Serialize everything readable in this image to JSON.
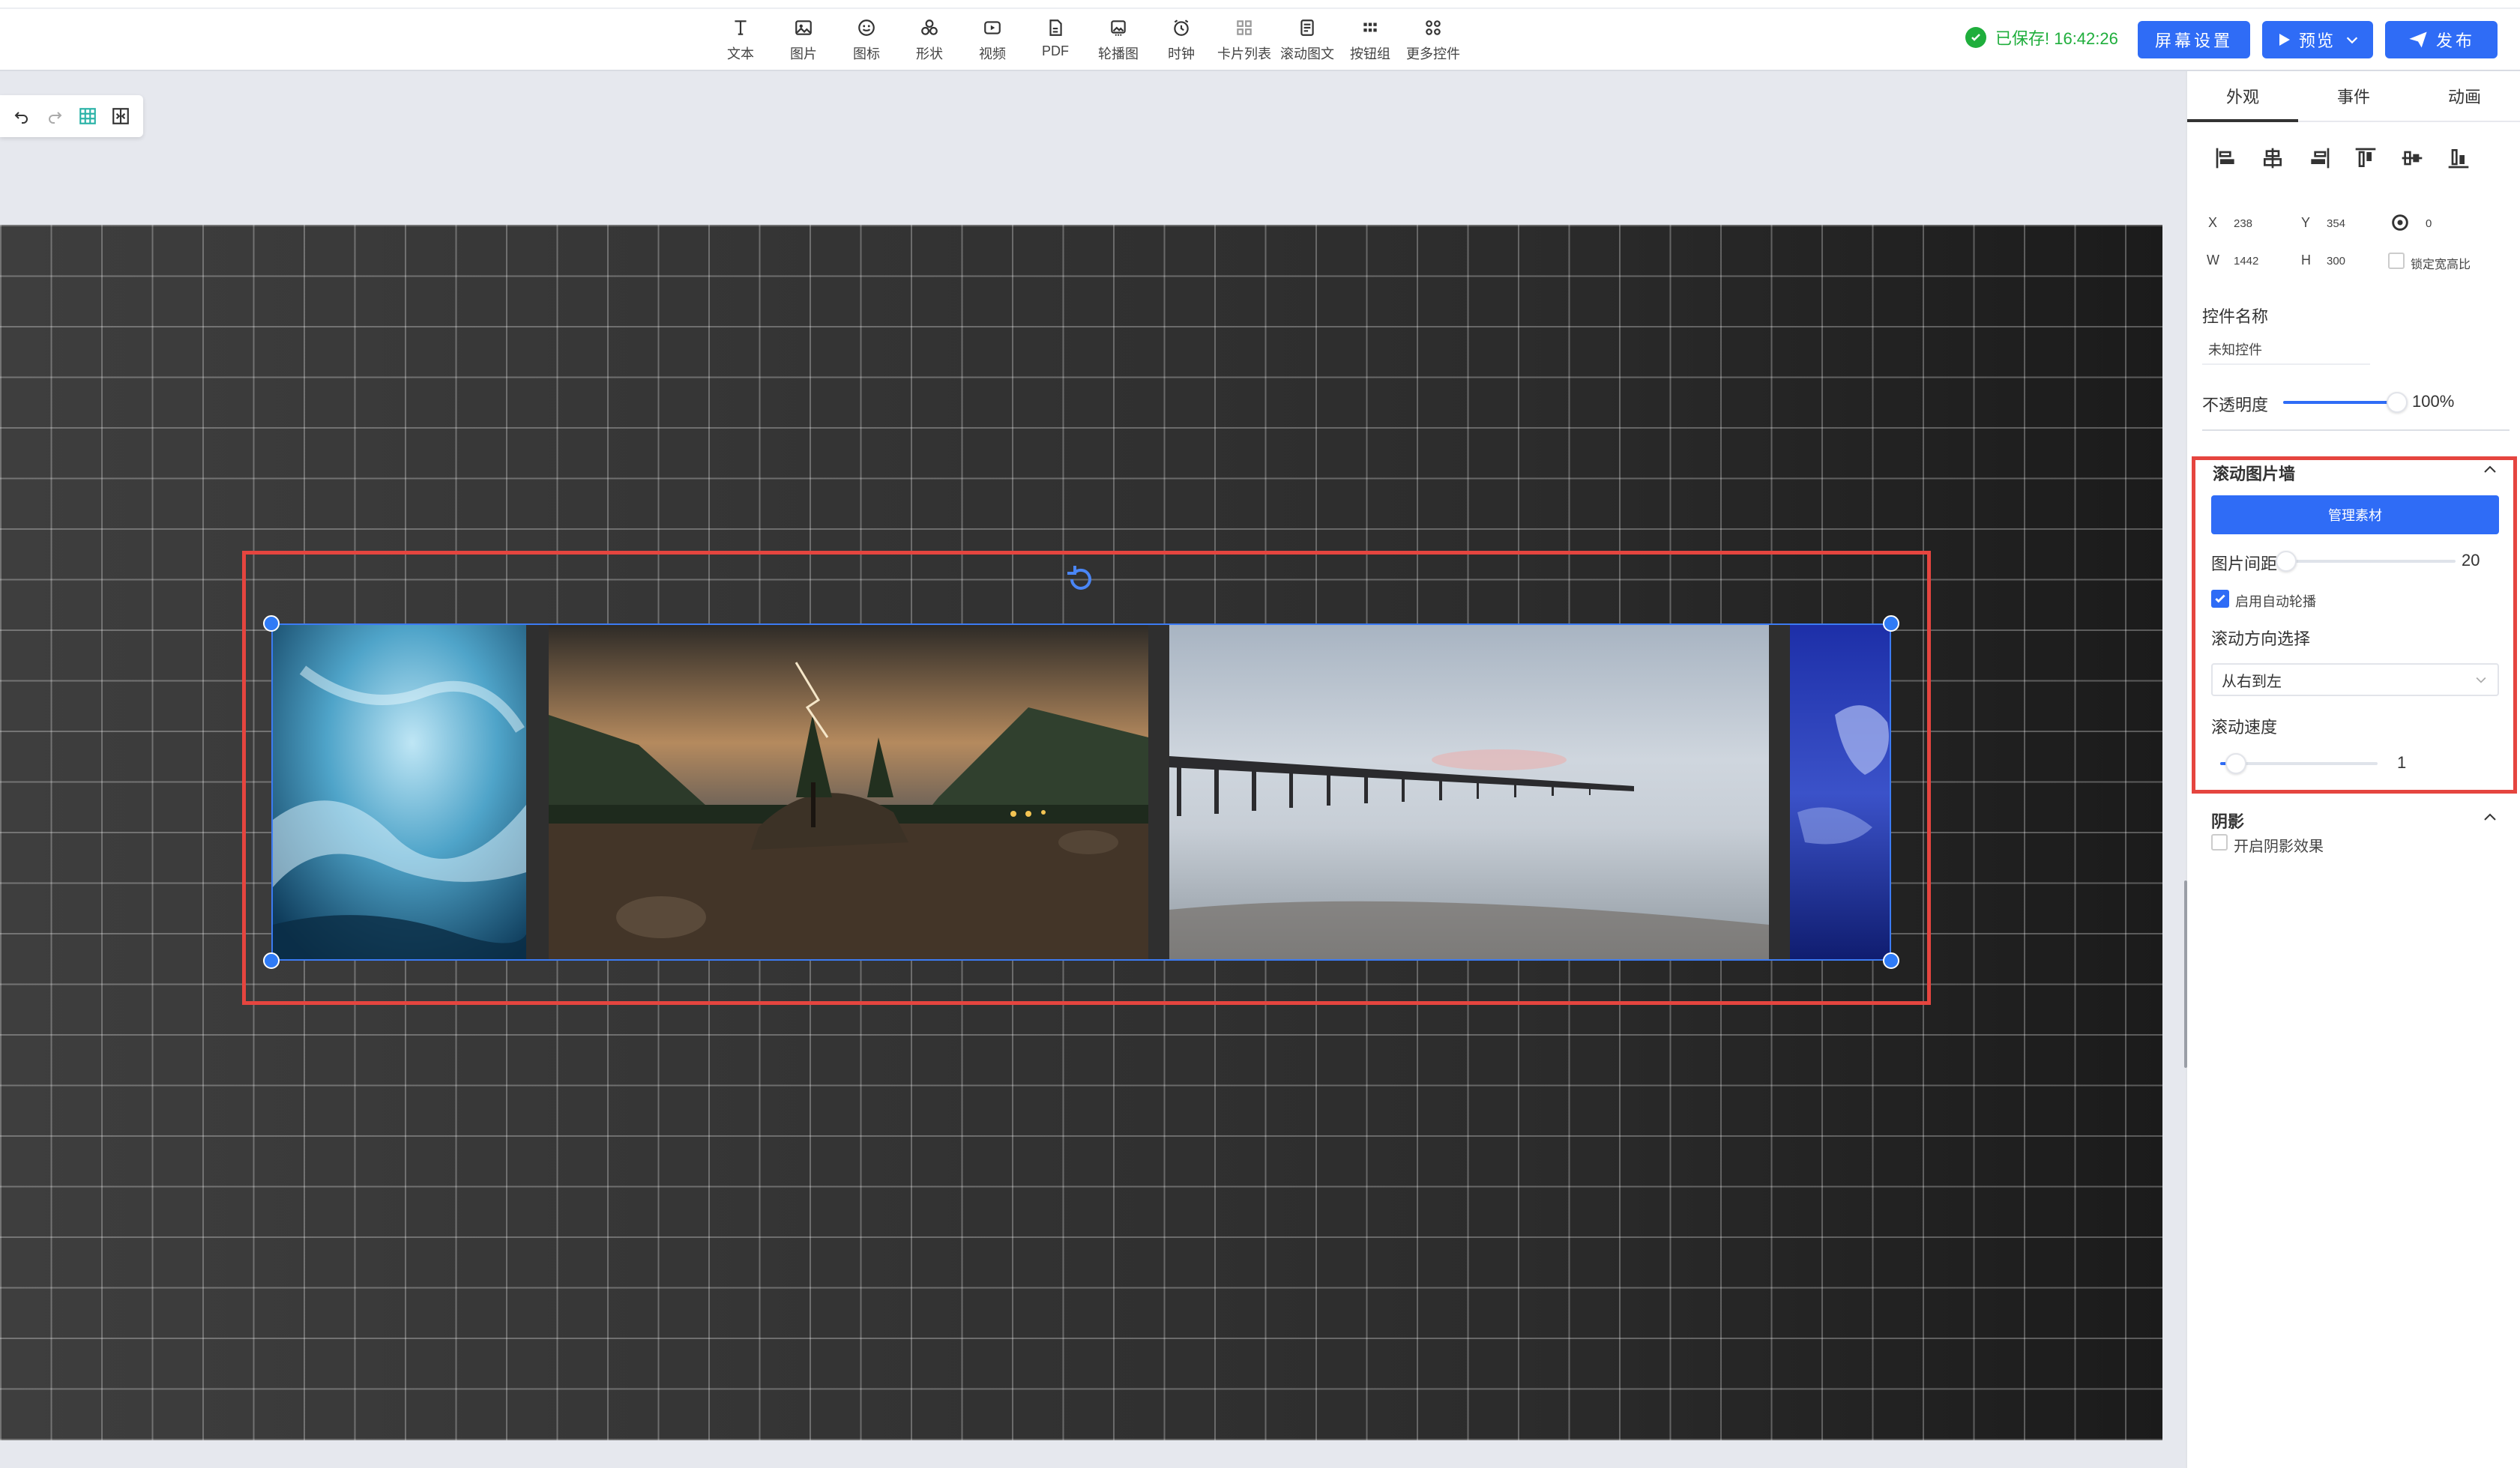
{
  "toolbar": {
    "items": [
      {
        "label": "文本",
        "icon": "text-icon"
      },
      {
        "label": "图片",
        "icon": "image-icon"
      },
      {
        "label": "图标",
        "icon": "emoji-icon"
      },
      {
        "label": "形状",
        "icon": "shapes-icon"
      },
      {
        "label": "视频",
        "icon": "video-icon"
      },
      {
        "label": "PDF",
        "icon": "pdf-icon"
      },
      {
        "label": "轮播图",
        "icon": "carousel-icon"
      },
      {
        "label": "时钟",
        "icon": "clock-icon"
      },
      {
        "label": "卡片列表",
        "icon": "card-list-icon"
      },
      {
        "label": "滚动图文",
        "icon": "scroll-text-icon"
      },
      {
        "label": "按钮组",
        "icon": "button-group-icon"
      },
      {
        "label": "更多控件",
        "icon": "more-widgets-icon"
      }
    ]
  },
  "header": {
    "saved_text": "已保存! 16:42:26",
    "screen_settings": "屏幕设置",
    "preview": "预览",
    "publish": "发布",
    "colors": {
      "accent": "#2f6cf6",
      "saved": "#1fae3c",
      "highlight": "#e5453f"
    }
  },
  "panel": {
    "tabs": [
      "外观",
      "事件",
      "动画"
    ],
    "active_tab": "外观",
    "geometry": {
      "x_label": "X",
      "x_value": "238",
      "y_label": "Y",
      "y_value": "354",
      "rotate_value": "0",
      "w_label": "W",
      "w_value": "1442",
      "h_label": "H",
      "h_value": "300",
      "lock_label": "锁定宽高比"
    },
    "name_label": "控件名称",
    "name_value": "未知控件",
    "opacity_label": "不透明度",
    "opacity_value": "100%",
    "opacity_level": 1.0,
    "section_title": "滚动图片墙",
    "manage_button": "管理素材",
    "gap_label": "图片间距",
    "gap_value": "20",
    "gap_level": 0.0,
    "autoplay_label": "启用自动轮播",
    "autoplay_checked": true,
    "direction_label": "滚动方向选择",
    "direction_value": "从右到左",
    "speed_label": "滚动速度",
    "speed_value": "1",
    "speed_level": 0.1,
    "shadow_title": "阴影",
    "shadow_label": "开启阴影效果",
    "shadow_checked": false
  }
}
